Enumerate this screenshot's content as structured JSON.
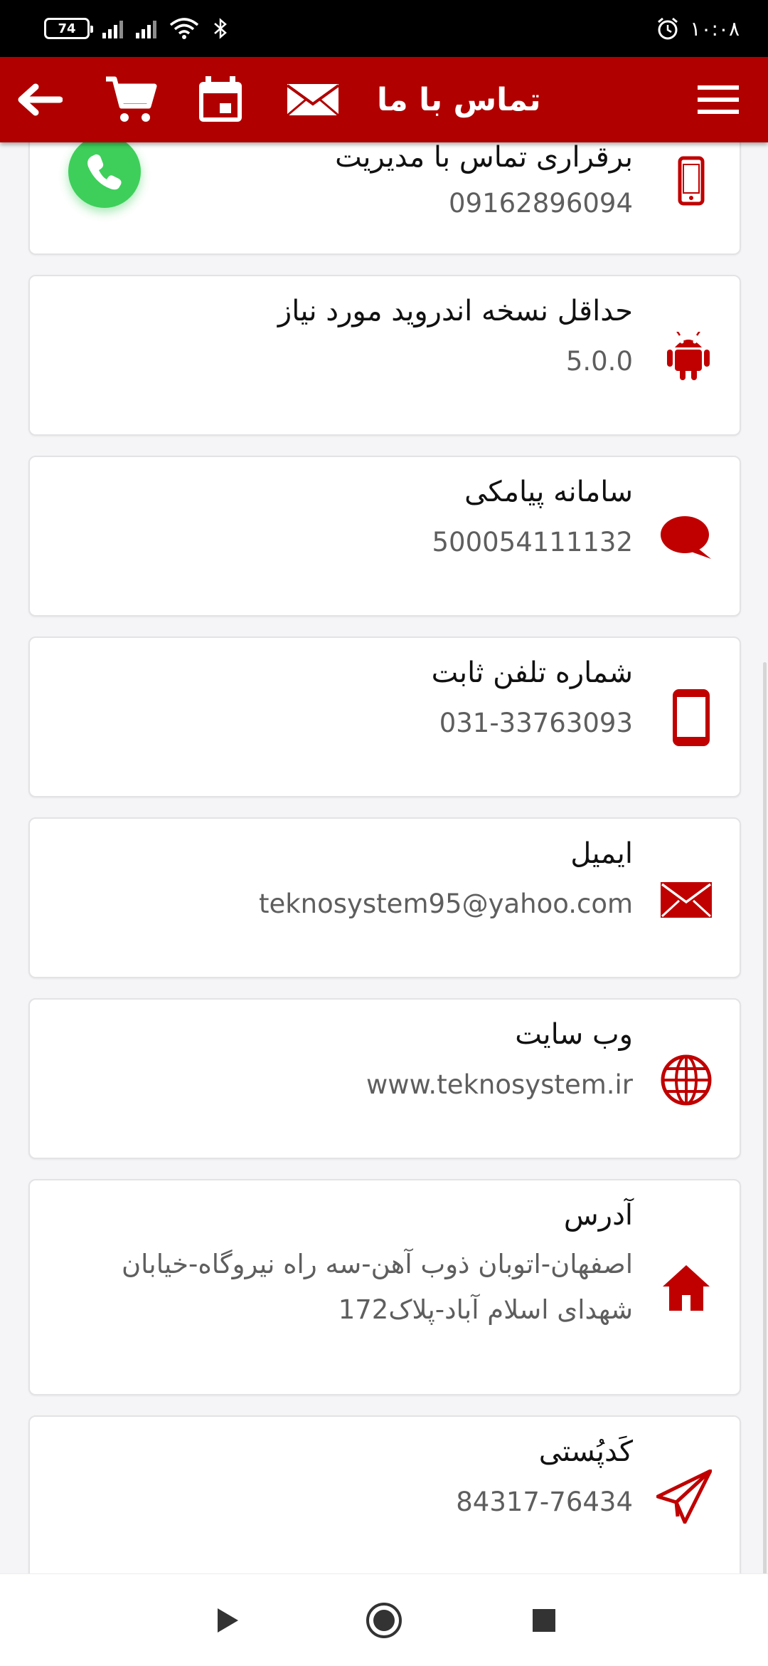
{
  "status_bar": {
    "battery": "74",
    "time": "۱۰:۰۸"
  },
  "app_bar": {
    "title": "تماس با ما"
  },
  "cards": [
    {
      "title": "برقراری تماس با مدیریت",
      "value": "09162896094",
      "icon": "mobile-phone-icon"
    },
    {
      "title": "حداقل نسخه اندروید مورد نیاز",
      "value": "5.0.0",
      "icon": "android-icon"
    },
    {
      "title": "سامانه پیامکی",
      "value": "500054111132",
      "icon": "chat-bubble-icon"
    },
    {
      "title": "شماره تلفن ثابت",
      "value": "031-33763093",
      "icon": "tablet-phone-icon"
    },
    {
      "title": "ایمیل",
      "value": "teknosystem95@yahoo.com",
      "icon": "envelope-icon"
    },
    {
      "title": "وب سایت",
      "value": "www.teknosystem.ir",
      "icon": "globe-icon"
    },
    {
      "title": "آدرس",
      "value": "اصفهان-اتوبان ذوب آهن-سه راه نیروگاه-خیابان شهدای اسلام آباد-پلاک172",
      "icon": "home-icon"
    },
    {
      "title": "کَدپُستی",
      "value": "84317-76434",
      "icon": "paper-plane-icon"
    }
  ],
  "colors": {
    "brand": "#b00000",
    "fab": "#3ecf5b",
    "status_bar": "#000000"
  }
}
